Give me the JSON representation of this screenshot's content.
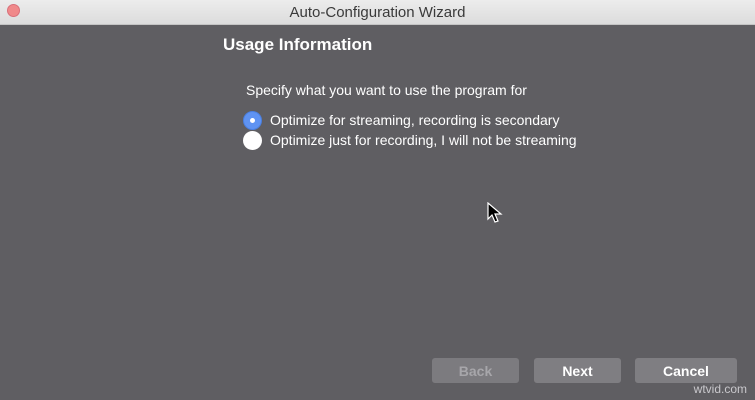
{
  "window": {
    "title": "Auto-Configuration Wizard"
  },
  "page": {
    "heading": "Usage Information",
    "prompt": "Specify what you want to use the program for"
  },
  "options": [
    {
      "label": "Optimize for streaming, recording is secondary",
      "selected": true
    },
    {
      "label": "Optimize just for recording, I will not be streaming",
      "selected": false
    }
  ],
  "buttons": {
    "back": "Back",
    "next": "Next",
    "cancel": "Cancel"
  },
  "watermark": "wtvid.com",
  "colors": {
    "background": "#5f5e62",
    "radio_selected": "#5f93f2",
    "button": "#7f7e82"
  }
}
